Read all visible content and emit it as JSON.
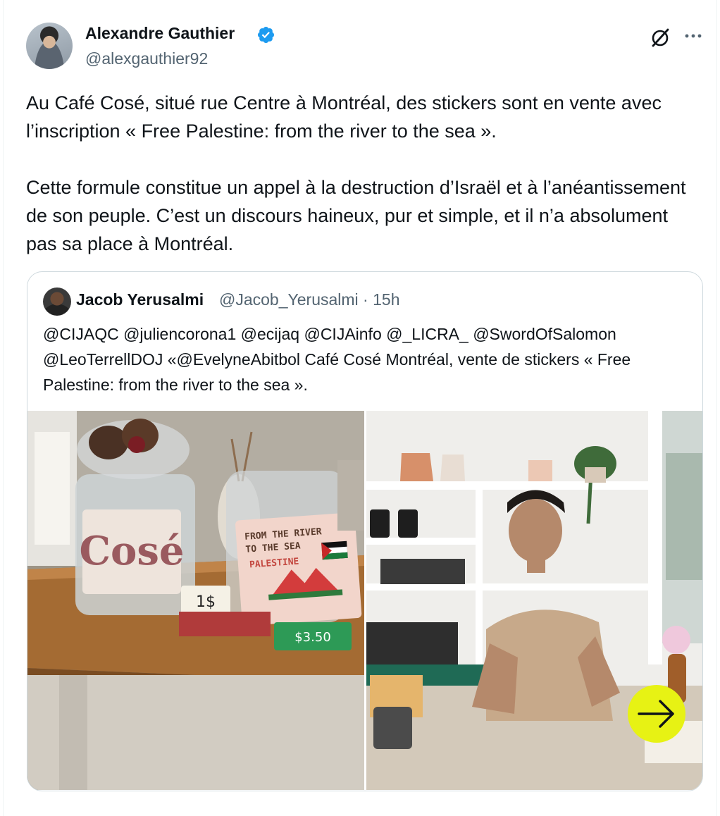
{
  "post": {
    "author": {
      "name": "Alexandre Gauthier",
      "handle": "@alexgauthier92",
      "verified": true,
      "verified_color": "#1d9bf0"
    },
    "paragraphs": [
      "Au Café Cosé, situé rue Centre à Montréal, des stickers sont en vente avec l’inscription « Free Palestine: from the river to the sea ».",
      "Cette formule constitue un appel à la destruction d’Israël et à l’anéantissement de son peuple. C’est un discours haineux, pur et simple, et il n’a absolument pas sa place à Montréal."
    ],
    "icons": [
      "grok-icon",
      "more-icon"
    ]
  },
  "quote": {
    "author": {
      "name": "Jacob Yerusalmi",
      "handle": "@Jacob_Yerusalmi",
      "separator": "·",
      "time": "15h"
    },
    "text": "@CIJAQC @juliencorona1 @ecijaq @CIJAinfo @_LICRA_ @SwordOfSalomon @LeoTerrellDOJ «@EvelyneAbitbol Café Cosé Montréal, vente de stickers « Free Palestine: from the river to the sea ».",
    "media": {
      "left_photo": {
        "jar_label": "Cosé",
        "sticker_lines": [
          "FROM THE RIVER",
          "TO THE SEA",
          "PALESTINE"
        ],
        "price_sign": "1$",
        "price_tag": "$3.50"
      },
      "right_photo": {},
      "next_button_color": "#e7f214"
    }
  }
}
